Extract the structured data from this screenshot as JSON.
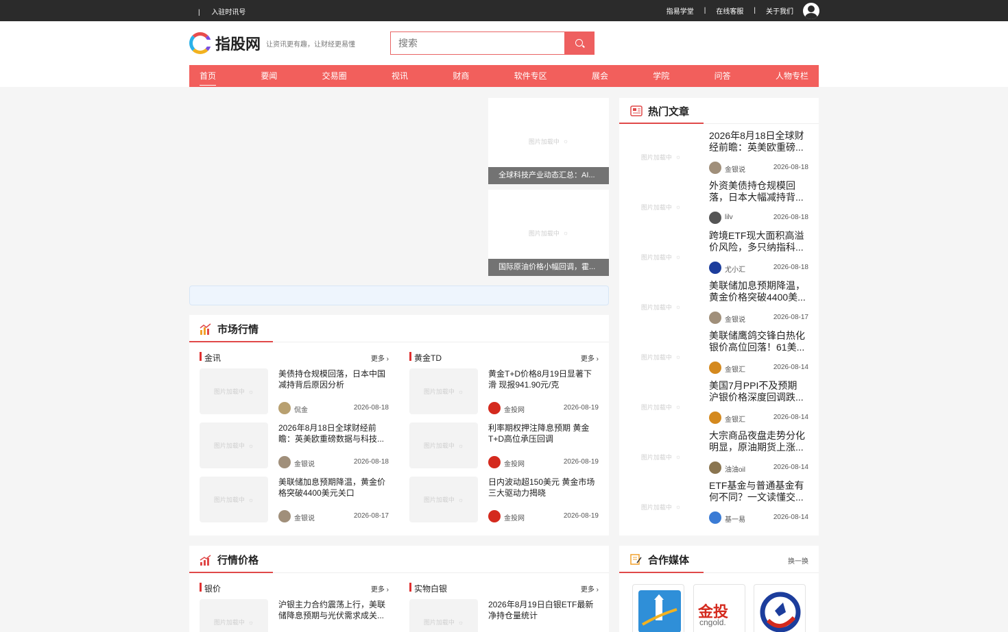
{
  "topbar": {
    "left_link": "入驻时讯号",
    "right_links": [
      "指易学堂",
      "在线客服",
      "关于我们"
    ]
  },
  "header": {
    "logo_name": "指股网",
    "slogan": "让资讯更有趣，让财经更易懂",
    "search_placeholder": "搜索"
  },
  "nav": [
    "首页",
    "要闻",
    "交易圈",
    "视讯",
    "财商",
    "软件专区",
    "展会",
    "学院",
    "问答",
    "人物专栏"
  ],
  "image_loading_text": "图片加载中",
  "slides": [
    {
      "caption": "全球科技产业动态汇总：AI..."
    },
    {
      "caption": "国际原油价格小幅回调，霍..."
    }
  ],
  "market": {
    "title": "市场行情",
    "columns": [
      {
        "title": "金讯",
        "more": "更多",
        "articles": [
          {
            "title": "美债持仓规模回落，日本中国减持背后原因分析",
            "author": "侃金",
            "date": "2026-08-18"
          },
          {
            "title": "2026年8月18日全球财经前瞻：英美欧重磅数据与科技...",
            "author": "金银说",
            "date": "2026-08-18"
          },
          {
            "title": "美联储加息预期降温，黄金价格突破4400美元关口",
            "author": "金银说",
            "date": "2026-08-17"
          }
        ]
      },
      {
        "title": "黄金TD",
        "more": "更多",
        "articles": [
          {
            "title": "黄金T+D价格8月19日显著下滑 现报941.90元/克",
            "author": "金投网",
            "date": "2026-08-19"
          },
          {
            "title": "利率期权押注降息预期 黄金T+D高位承压回调",
            "author": "金投网",
            "date": "2026-08-19"
          },
          {
            "title": "日内波动超150美元 黄金市场三大驱动力揭晓",
            "author": "金投网",
            "date": "2026-08-19"
          }
        ]
      }
    ]
  },
  "prices": {
    "title": "行情价格",
    "columns": [
      {
        "title": "银价",
        "more": "更多",
        "articles": [
          {
            "title": "沪银主力合约震荡上行，美联储降息预期与光伏需求成关..."
          }
        ]
      },
      {
        "title": "实物白银",
        "more": "更多",
        "articles": [
          {
            "title": "2026年8月19日白银ETF最新净持仓量统计"
          }
        ]
      }
    ]
  },
  "hot": {
    "title": "热门文章",
    "items": [
      {
        "title": "2026年8月18日全球财经前瞻：英美欧重磅...",
        "author": "金银说",
        "date": "2026-08-18",
        "avatar_color": "#a08f7a"
      },
      {
        "title": "外资美债持仓规模回落，日本大幅减持背...",
        "author": "lilv",
        "date": "2026-08-18",
        "avatar_color": "#555555"
      },
      {
        "title": "跨境ETF现大面积高溢价风险，多只纳指科...",
        "author": "尤小汇",
        "date": "2026-08-18",
        "avatar_color": "#1c3d9c"
      },
      {
        "title": "美联储加息预期降温，黄金价格突破4400美...",
        "author": "金银说",
        "date": "2026-08-17",
        "avatar_color": "#a08f7a"
      },
      {
        "title": "美联储鹰鸽交锋白热化 银价高位回落！61美...",
        "author": "金银汇",
        "date": "2026-08-14",
        "avatar_color": "#d4891e"
      },
      {
        "title": "美国7月PPI不及预期 沪银价格深度回调跌...",
        "author": "金银汇",
        "date": "2026-08-14",
        "avatar_color": "#d4891e"
      },
      {
        "title": "大宗商品夜盘走势分化明显，原油期货上涨...",
        "author": "油油oil",
        "date": "2026-08-14",
        "avatar_color": "#8a7550"
      },
      {
        "title": "ETF基金与普通基金有何不同？一文读懂交...",
        "author": "基一易",
        "date": "2026-08-14",
        "avatar_color": "#3a7bd5"
      }
    ]
  },
  "media": {
    "title": "合作媒体",
    "switch_label": "换一换",
    "logo_texts": [
      "金投",
      "cngold."
    ]
  },
  "colors": {
    "brand_red": "#f25f5c",
    "accent_red": "#e04848",
    "topbar_bg": "#2b2b2b"
  }
}
